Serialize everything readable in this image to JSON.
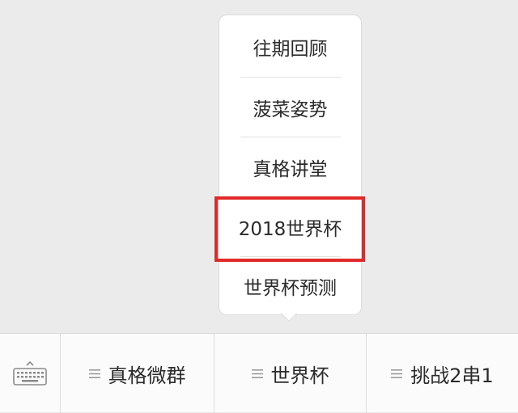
{
  "popup_menu": {
    "items": [
      {
        "label": "往期回顾"
      },
      {
        "label": "菠菜姿势"
      },
      {
        "label": "真格讲堂"
      },
      {
        "label": "2018世界杯"
      },
      {
        "label": "世界杯预测"
      }
    ],
    "highlighted_item": "2018世界杯",
    "highlight_color": "#e02a2a"
  },
  "bottom_bar": {
    "keyboard_icon": "keyboard-icon",
    "tabs": [
      {
        "label": "真格微群",
        "icon": "menu-lines-icon"
      },
      {
        "label": "世界杯",
        "icon": "menu-lines-icon"
      },
      {
        "label": "挑战2串1",
        "icon": "menu-lines-icon"
      }
    ]
  }
}
